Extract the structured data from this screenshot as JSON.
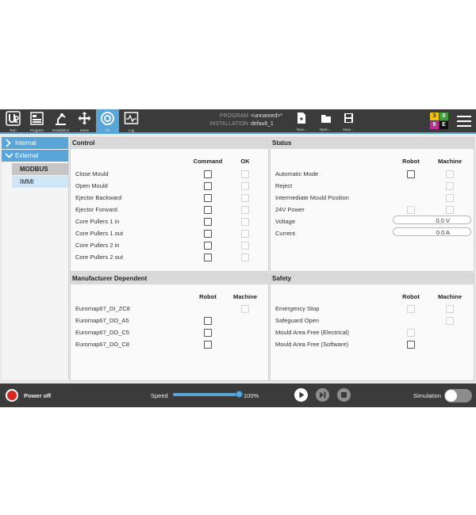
{
  "nav": [
    {
      "label": "Run",
      "icon": "ur-logo-icon"
    },
    {
      "label": "Program",
      "icon": "program-icon"
    },
    {
      "label": "Installation",
      "icon": "installation-icon"
    },
    {
      "label": "Move",
      "icon": "move-icon"
    },
    {
      "label": "I/O",
      "icon": "io-icon"
    },
    {
      "label": "Log",
      "icon": "log-icon"
    }
  ],
  "program": {
    "program_key": "PROGRAM",
    "program_value": "<unnamed>*",
    "installation_key": "INSTALLATION",
    "installation_value": "default_1"
  },
  "file": {
    "new_label": "New...",
    "open_label": "Open...",
    "save_label": "Save..."
  },
  "badge": {
    "tl": "3",
    "tr": "0",
    "bl": "9",
    "br": "E"
  },
  "sidebar": {
    "internal": "Internal",
    "external": "External",
    "subs": [
      {
        "label": "MODBUS"
      },
      {
        "label": "IMMI"
      }
    ]
  },
  "control": {
    "title": "Control",
    "col_command": "Command",
    "col_ok": "OK",
    "rows": [
      "Close Mould",
      "Open Mould",
      "Ejector Backward",
      "Ejector Forward",
      "Core Pullers 1 in",
      "Core Pullers 1 out",
      "Core Pullers 2 in",
      "Core Pullers 2 out"
    ]
  },
  "status": {
    "title": "Status",
    "col_robot": "Robot",
    "col_machine": "Machine",
    "rows": [
      "Automatic Mode",
      "Reject",
      "Intermediate Mould Position",
      "24V Power",
      "Voltage",
      "Current"
    ],
    "voltage": "0.0 V",
    "current": "0.0 A"
  },
  "manufacturer": {
    "title": "Manufacturer Dependent",
    "col_robot": "Robot",
    "col_machine": "Machine",
    "rows": [
      "Euromap67_DI_ZC8",
      "Euromap67_DO_A5",
      "Euromap67_DO_C5",
      "Euromap67_DO_C8"
    ]
  },
  "safety": {
    "title": "Safety",
    "col_robot": "Robot",
    "col_machine": "Machine",
    "rows": [
      "Emergency Stop",
      "Safeguard Open",
      "Mould Area Free (Electrical)",
      "Mould Area Free (Software)"
    ]
  },
  "bottom": {
    "power": "Power off",
    "speed_label": "Speed",
    "speed_value": "100%",
    "speed_fraction": 1.0,
    "simulation": "Simulation"
  },
  "colors": {
    "accent": "#5aa5d8",
    "bar": "#3b3b3b",
    "power": "#d8261e"
  }
}
